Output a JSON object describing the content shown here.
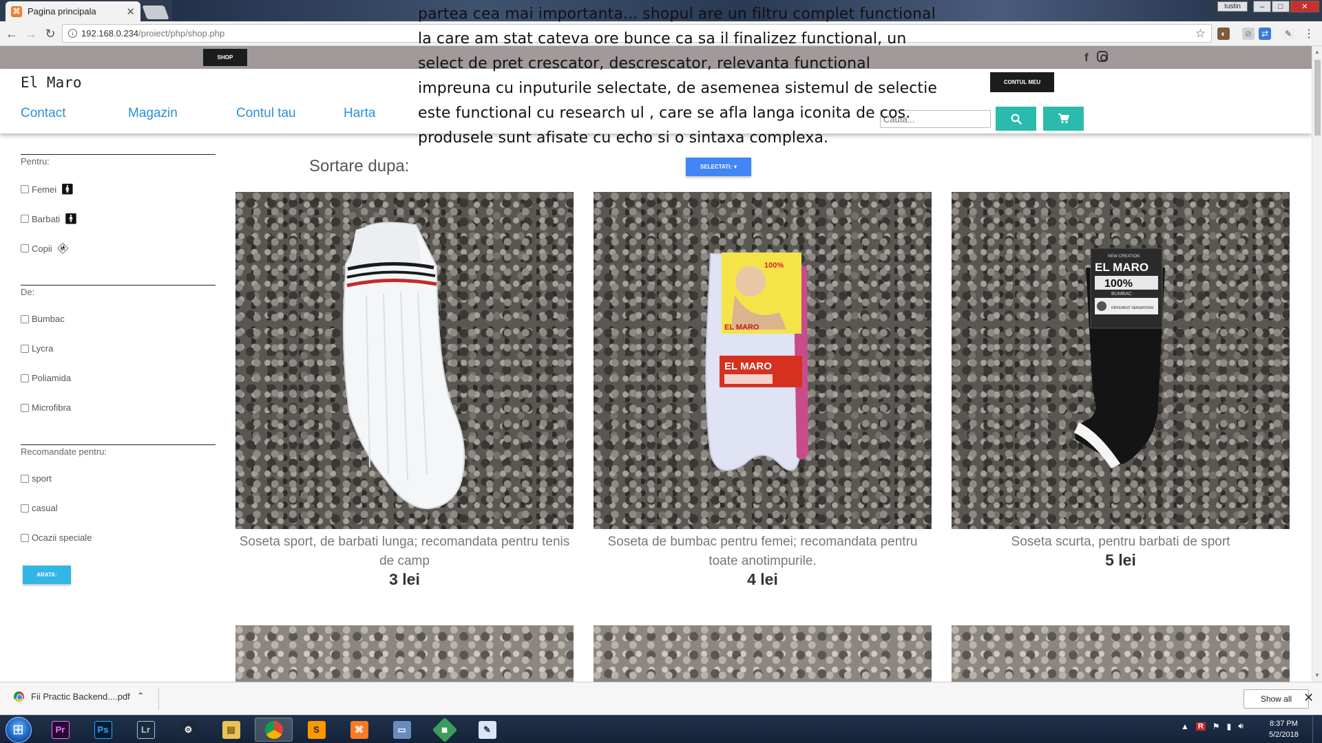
{
  "browser": {
    "tab_title": "Pagina principala",
    "tab_close": "✕",
    "user_chip": "Iustin",
    "window_buttons": [
      "–",
      "□",
      "✕"
    ],
    "url_host": "192.168.0.234",
    "url_path": "/proiect/php/shop.php"
  },
  "site": {
    "shop_label": "SHOP",
    "brand": "El Maro",
    "account_label": "CONTUL MEU",
    "nav": [
      "Contact",
      "Magazin",
      "Contul tau",
      "Harta"
    ],
    "search_placeholder": "Cauta..."
  },
  "overlay_text": "partea cea mai importanta... shopul are un filtru complet functional la care am stat cateva ore bunce ca sa il finalizez functional, un select de pret crescator, descrescator, relevanta functional impreuna cu inputurile selectate, de asemenea sistemul de selectie este functional cu research ul , care se afla langa iconita de cos. produsele sunt afisate cu echo si o sintaxa complexa.",
  "filters": {
    "sections": [
      {
        "label": "Pentru:",
        "items": [
          "Femei",
          "Barbati",
          "Copii"
        ]
      },
      {
        "label": "De:",
        "items": [
          "Bumbac",
          "Lycra",
          "Poliamida",
          "Microfibra"
        ]
      },
      {
        "label": "Recomandate pentru:",
        "items": [
          "sport",
          "casual",
          "Ocazii speciale"
        ]
      }
    ],
    "show_button": "ARATA:"
  },
  "sort": {
    "label": "Sortare dupa:",
    "select_label": "SELECTATI:"
  },
  "products": [
    {
      "desc": "Soseta sport, de barbati lunga; recomandata pentru tenis de camp",
      "price": "3 lei"
    },
    {
      "desc": "Soseta de bumbac pentru femei; recomandata pentru toate anotimpurile.",
      "price": "4 lei"
    },
    {
      "desc": "Soseta scurta, pentru barbati de sport",
      "price": "5 lei"
    }
  ],
  "package_labels": {
    "brand": "EL MARO",
    "pct": "100%",
    "material": "BUMBAC",
    "new": "NEW CREATION",
    "tag": "DIFFERENT SENSATIONS"
  },
  "downloads": {
    "file": "Fii Practic Backend....pdf",
    "show_all": "Show all"
  },
  "taskbar": {
    "apps": [
      "Pr",
      "Ps",
      "Lr"
    ],
    "time": "8:37 PM",
    "date": "5/2/2018"
  },
  "colors": {
    "nav_link": "#2b8fd6",
    "teal_button": "#2bbbad",
    "blue_button": "#4285f4",
    "light_blue_button": "#33b5e5",
    "top_strip": "#a29a9a"
  }
}
